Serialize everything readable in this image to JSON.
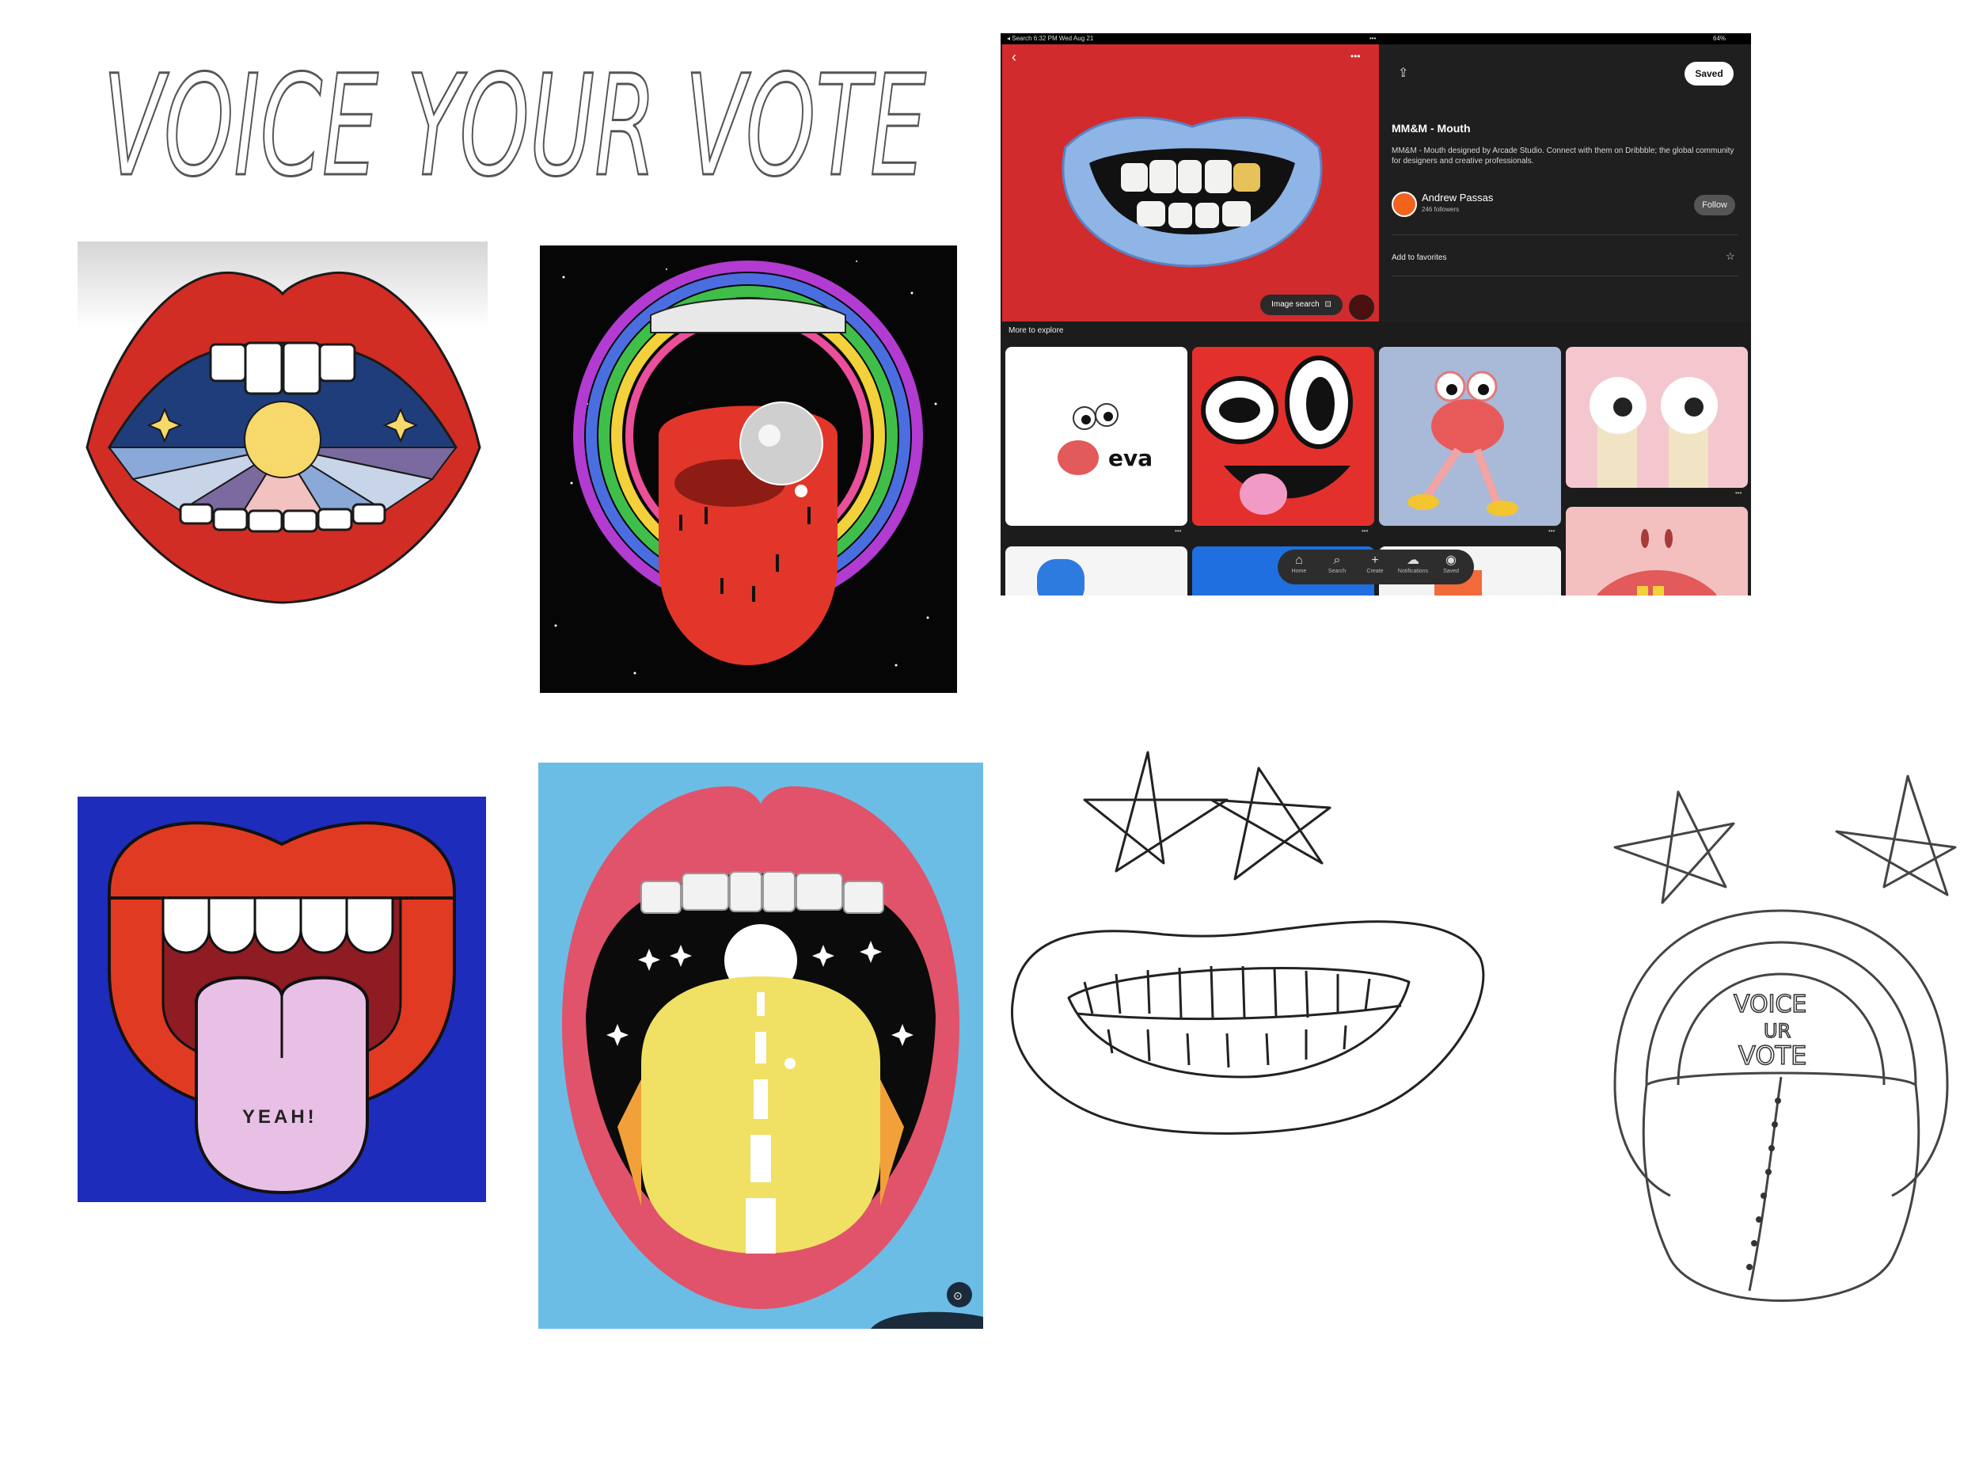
{
  "headline": "VOICE YOUR VOTE",
  "sketch_lettering": [
    "VOICE",
    "UR",
    "VOTE"
  ],
  "yeah_label": "YEAH!",
  "phone": {
    "status": {
      "left": "◂ Search  6:32 PM  Wed Aug 21",
      "battery": "64%"
    },
    "more_icon": "•••",
    "share_icon": "share-icon",
    "saved_button": "Saved",
    "title": "MM&M - Mouth",
    "description": "MM&M - Mouth designed by Arcade Studio. Connect with them on Dribbble; the global community for designers and creative professionals.",
    "author": "Andrew Passas",
    "followers": "246 followers",
    "follow_button": "Follow",
    "add_to_favorites": "Add to favorites",
    "image_search": "Image search",
    "more_to_explore": "More to explore",
    "thumb_text": "eva",
    "nav": [
      "Home",
      "Search",
      "Create",
      "Notifications",
      "Saved"
    ],
    "colors": {
      "hero_red": "#d12b2e",
      "panel_dark": "#1f1f1f"
    }
  }
}
